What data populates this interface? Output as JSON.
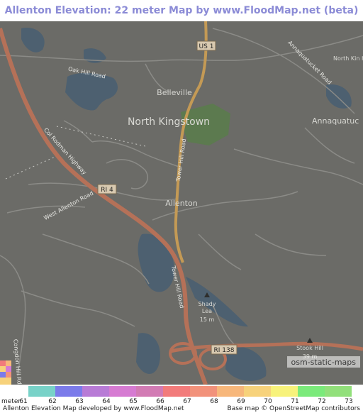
{
  "title": "Allenton Elevation: 22 meter Map by www.FloodMap.net (beta)",
  "map": {
    "places": {
      "north_kingstown": "North Kingstown",
      "belleville": "Belleville",
      "allenton": "Allenton",
      "annaquatucket": "Annaquatuc",
      "north_kingstown_hs": "North Kin High Sc",
      "shady_lea_name": "Shady",
      "shady_lea_name2": "Lea",
      "shady_lea_elev": "15 m",
      "stook_hill": "Stook Hill",
      "stook_hill_elev": "39 m"
    },
    "roads": {
      "oak_hill": "Oak Hill Road",
      "annaquatucket_road": "Annaquatucket Road",
      "col_rodman": "Col Rodman Highway",
      "tower_hill_north": "Tower Hill Road",
      "tower_hill_south": "Tower Hill Road",
      "west_allenton": "West Allenton Road",
      "congdon_hill": "Congdon Hill Rd"
    },
    "shields": {
      "us1": "US 1",
      "ri4": "RI 4",
      "ri138": "RI 138"
    },
    "attribution_badge": "osm-static-maps"
  },
  "legend": {
    "unit": "meter",
    "labels": [
      "61",
      "62",
      "63",
      "64",
      "65",
      "66",
      "67",
      "68",
      "69",
      "70",
      "71",
      "72",
      "73"
    ],
    "colors": [
      "#78d2c8",
      "#7b7bea",
      "#b87bd6",
      "#d67bd2",
      "#d27bb4",
      "#f27b7b",
      "#f2927b",
      "#f7b77b",
      "#f7d27b",
      "#f7f27b",
      "#7bea7b",
      "#92e07b"
    ]
  },
  "footer": {
    "left": "Allenton Elevation Map developed by www.FloodMap.net",
    "right": "Base map © OpenStreetMap contributors"
  },
  "colors": {
    "map_base": "#6b6b67",
    "water": "#4a5f73",
    "park": "#5f7a52",
    "road_major": "#b8735a",
    "road_minor": "#8a8a86",
    "road_us": "#c99a55"
  }
}
